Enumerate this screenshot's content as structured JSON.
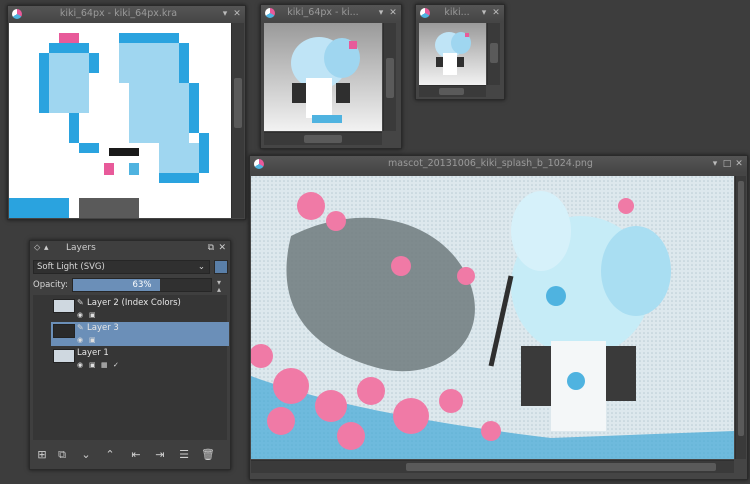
{
  "windows": {
    "main_zoom": {
      "title": "kiki_64px - kiki_64px.kra"
    },
    "preview_small": {
      "title": "kiki_64px - ki..."
    },
    "preview_tiny": {
      "title": "kiki..."
    },
    "splash": {
      "title": "mascot_20131006_kiki_splash_b_1024.png"
    }
  },
  "window_buttons": {
    "minimize": "▾",
    "maximize": "□",
    "close": "✕"
  },
  "layers_panel": {
    "title": "Layers",
    "blend_mode": "Soft Light (SVG)",
    "opacity_label": "Opacity:",
    "opacity_value": "63%",
    "opacity_fraction": 0.63,
    "layers": [
      {
        "name": "Layer 2 (Index Colors)",
        "selected": false
      },
      {
        "name": "Layer 3",
        "selected": true
      },
      {
        "name": "Layer 1",
        "selected": false
      }
    ],
    "bottom_buttons": [
      "add-layer",
      "duplicate-layer",
      "move-down",
      "move-up",
      "properties",
      "merge-down",
      "settings",
      "delete-layer"
    ]
  },
  "colors": {
    "selection": "#6b8fb8",
    "accent_blue": "#4fb3e0",
    "accent_pink": "#e85a9a"
  }
}
